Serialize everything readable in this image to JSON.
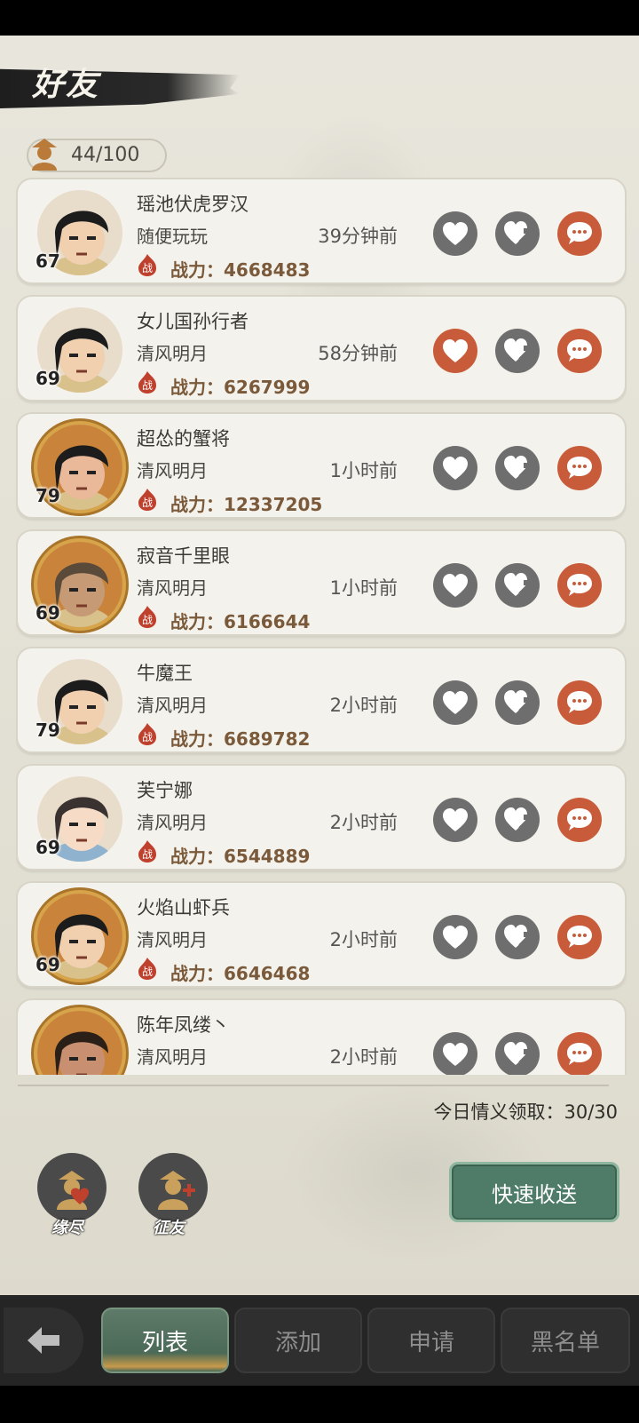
{
  "header": {
    "title": "好友"
  },
  "friend_count": "44/100",
  "friends": [
    {
      "name": "瑶池伏虎罗汉",
      "signature": "随便玩玩",
      "time": "39分钟前",
      "level": "67",
      "power": "战力：4668483",
      "heart_sent": false
    },
    {
      "name": "女儿国孙行者",
      "signature": "清风明月",
      "time": "58分钟前",
      "level": "69",
      "power": "战力：6267999",
      "heart_sent": true
    },
    {
      "name": "超怂的蟹将",
      "signature": "清风明月",
      "time": "1小时前",
      "level": "79",
      "power": "战力：12337205",
      "heart_sent": false
    },
    {
      "name": "寂音千里眼",
      "signature": "清风明月",
      "time": "1小时前",
      "level": "69",
      "power": "战力：6166644",
      "heart_sent": false
    },
    {
      "name": "牛魔王",
      "signature": "清风明月",
      "time": "2小时前",
      "level": "79",
      "power": "战力：6689782",
      "heart_sent": false
    },
    {
      "name": "芙宁娜",
      "signature": "清风明月",
      "time": "2小时前",
      "level": "69",
      "power": "战力：6544889",
      "heart_sent": false
    },
    {
      "name": "火焰山虾兵",
      "signature": "清风明月",
      "time": "2小时前",
      "level": "69",
      "power": "战力：6646468",
      "heart_sent": false
    },
    {
      "name": "陈年凤缕丶",
      "signature": "清风明月",
      "time": "2小时前",
      "level": "",
      "power": "",
      "heart_sent": false
    }
  ],
  "power_badge": "战",
  "daily_claim": "今日情义领取：30/30",
  "actions": {
    "remove_label": "缘尽",
    "recruit_label": "征友",
    "quick_send_label": "快速收送"
  },
  "tabs": [
    {
      "label": "列表",
      "active": true
    },
    {
      "label": "添加",
      "active": false
    },
    {
      "label": "申请",
      "active": false
    },
    {
      "label": "黑名单",
      "active": false
    }
  ],
  "colors": {
    "accent_red": "#c85c3a",
    "button_grey": "#6e6e6e",
    "quick_green": "#4e7c68"
  }
}
